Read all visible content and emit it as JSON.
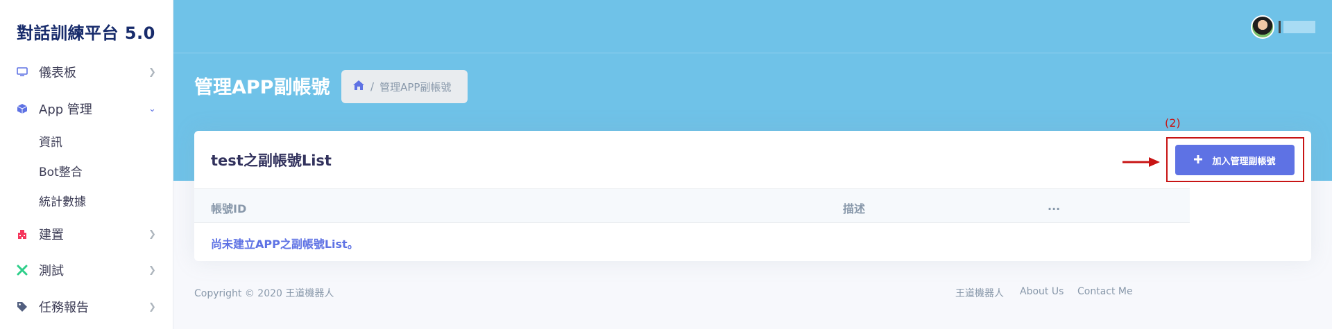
{
  "brand": "對話訓練平台 5.0",
  "sidebar": {
    "items": [
      {
        "label": "儀表板",
        "icon": "monitor-icon"
      },
      {
        "label": "App 管理",
        "icon": "cube-icon"
      },
      {
        "label": "建置",
        "icon": "building-icon"
      },
      {
        "label": "測試",
        "icon": "tools-icon"
      },
      {
        "label": "任務報告",
        "icon": "tag-icon"
      }
    ],
    "subitems": [
      "資訊",
      "Bot整合",
      "統計數據"
    ]
  },
  "header": {
    "page_title": "管理APP副帳號",
    "breadcrumb_separator": "/",
    "breadcrumb_current": "管理APP副帳號"
  },
  "card": {
    "title": "test之副帳號List",
    "add_button_label": "加入管理副帳號",
    "columns": [
      "帳號ID",
      "描述",
      "..."
    ],
    "empty_message": "尚未建立APP之副帳號List。"
  },
  "annotation": {
    "step_label": "(2)",
    "color": "#c81414"
  },
  "footer": {
    "copyright": "Copyright © 2020 王道機器人",
    "links": [
      "王道機器人",
      "About Us",
      "Contact Me"
    ]
  },
  "colors": {
    "header": "#6fc2e8",
    "primary": "#5e72e4",
    "sidebar_bg": "#ffffff"
  }
}
